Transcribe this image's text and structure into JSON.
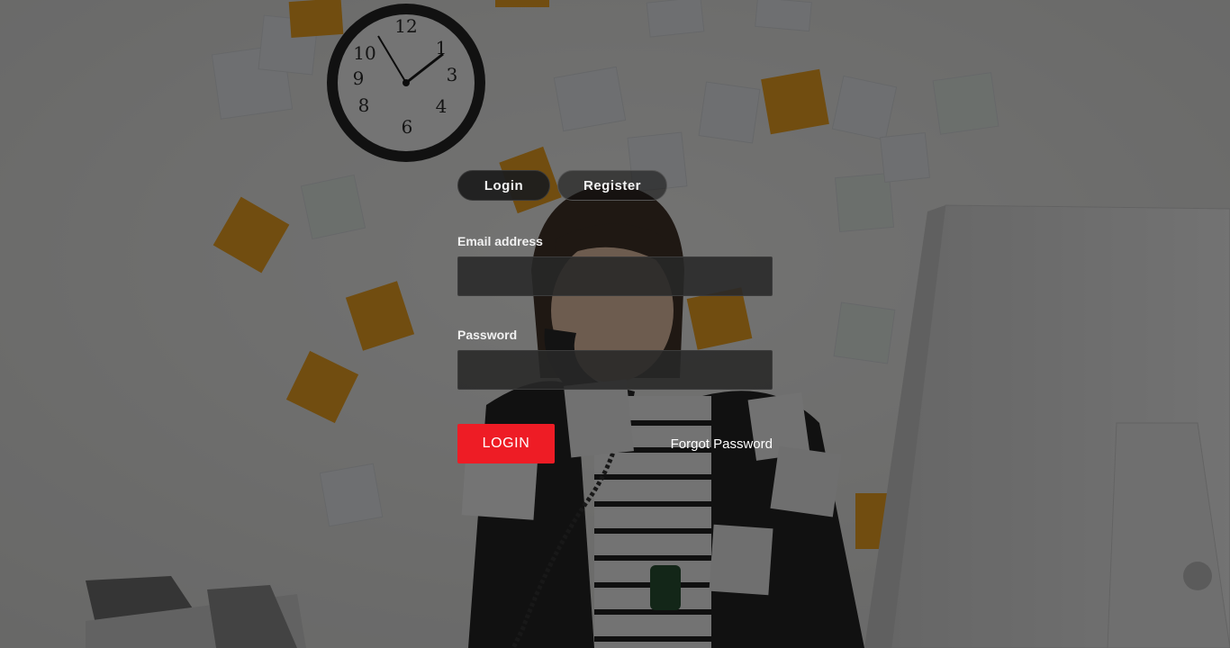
{
  "tabs": {
    "login_label": "Login",
    "register_label": "Register",
    "active": "login"
  },
  "form": {
    "email_label": "Email address",
    "email_value": "",
    "password_label": "Password",
    "password_value": "",
    "login_button_label": "LOGIN",
    "forgot_password_label": "Forgot Password"
  },
  "colors": {
    "accent": "#ee1c25",
    "sticky_note": "#f0a01a",
    "overlay": "#0a0a0a"
  }
}
